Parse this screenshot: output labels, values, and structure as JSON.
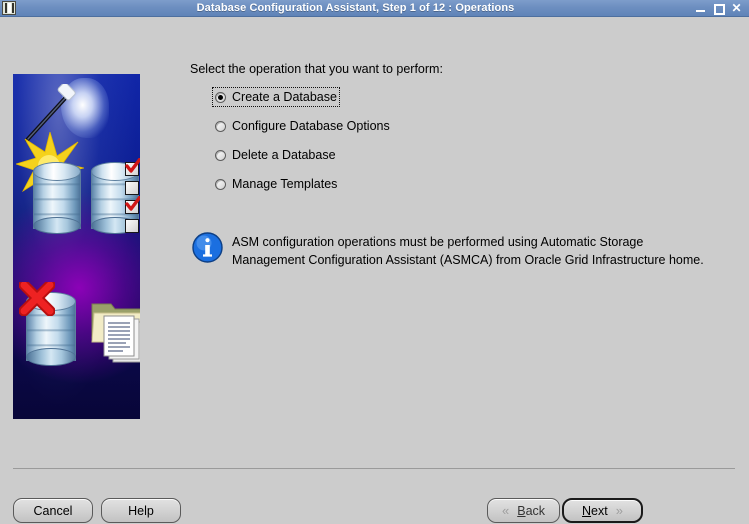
{
  "window": {
    "title": "Database Configuration Assistant, Step 1 of 12 : Operations",
    "icon": "database-app-icon",
    "controls": {
      "minimize": "minimize-icon",
      "maximize": "maximize-icon",
      "close": "✕"
    }
  },
  "illustration": {
    "alt": "Database creation wizard illustration with magic wand, database cylinders, red X and document folders",
    "elements": [
      "magic-wand-icon",
      "star-burst-icon",
      "database-cylinder-icon",
      "checklist-icon",
      "red-x-icon",
      "folder-documents-icon"
    ],
    "colors": {
      "background_blue": "#0d1f96",
      "background_purple": "#9600be",
      "cylinder_light": "#eef6fb",
      "red_x": "#cc1111"
    }
  },
  "main": {
    "prompt": "Select the operation that you want to perform:",
    "options": [
      {
        "label": "Create a Database",
        "selected": true
      },
      {
        "label": "Configure Database Options",
        "selected": false
      },
      {
        "label": "Delete a Database",
        "selected": false
      },
      {
        "label": "Manage Templates",
        "selected": false
      }
    ],
    "note": {
      "icon": "info-icon",
      "line1": "ASM configuration operations must be performed using Automatic Storage",
      "line2": "Management Configuration Assistant (ASMCA) from Oracle Grid Infrastructure home.",
      "icon_color": "#1b6fe0"
    }
  },
  "footer": {
    "cancel": "Cancel",
    "help": "Help",
    "back": {
      "prefix": "B",
      "rest": "ack",
      "chevron": "«"
    },
    "next": {
      "prefix": "N",
      "rest": "ext",
      "chevron": "»"
    }
  },
  "theme": {
    "window_background": "#cccccc",
    "titlebar_blue": "#6d8fc0",
    "titlebar_text": "#ffffff",
    "separator": "#9a9a9a"
  }
}
